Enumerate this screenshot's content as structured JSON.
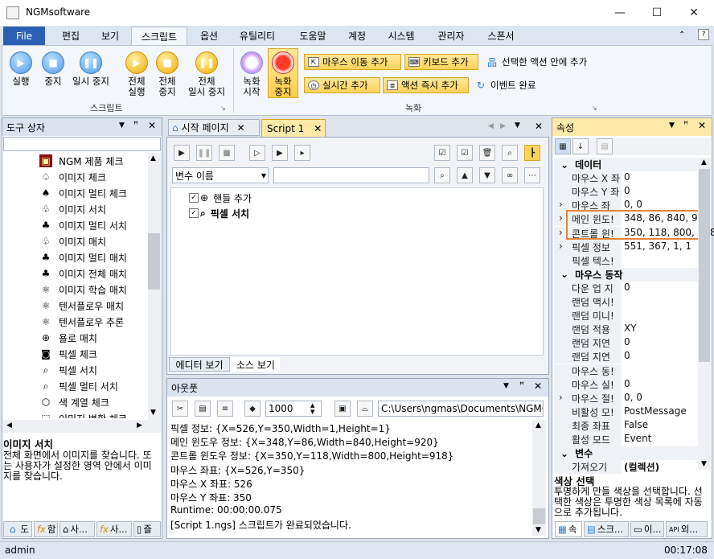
{
  "title_bar": {
    "title": "NGMsoftware",
    "minimize": "—",
    "maximize": "☐",
    "close": "✕"
  },
  "menu": {
    "file": "File",
    "tabs": [
      "편집",
      "보기",
      "스크립트",
      "옵션",
      "유틸리티",
      "도움말",
      "계정",
      "시스템",
      "관리자",
      "스폰서"
    ],
    "active_tab": "스크립트"
  },
  "ribbon": {
    "script_group": {
      "label": "스크립트",
      "run": "실행",
      "stop": "중지",
      "pause": "일시 중지",
      "run_all_1": "전체",
      "run_all_2": "실행",
      "stop_all_1": "전체",
      "stop_all_2": "중지",
      "pause_all_1": "전체",
      "pause_all_2": "일시 중지"
    },
    "record_group": {
      "label": "녹화",
      "record_start_1": "녹화",
      "record_start_2": "시작",
      "record_stop_1": "녹화",
      "record_stop_2": "중지",
      "add_mouse_move": "마우스 이동 추가",
      "add_keyboard": "키보드 추가",
      "add_in_action": "선택한 액션 안에 추가",
      "add_realtime": "실시간 추가",
      "add_action_now": "액션 즉시 추가",
      "event_complete": "이벤트 완료"
    }
  },
  "toolbox": {
    "title": "도구 상자",
    "items": [
      {
        "label": "NGM 제품 체크",
        "icon": "ngm-icon"
      },
      {
        "label": "이미지 체크",
        "icon": "tree-outline-icon"
      },
      {
        "label": "이미지 멀티 체크",
        "icon": "tree-icon"
      },
      {
        "label": "이미지 서치",
        "icon": "trees-outline-icon"
      },
      {
        "label": "이미지 멀티 서치",
        "icon": "trees-icon"
      },
      {
        "label": "이미지 매치",
        "icon": "trees-outline-icon"
      },
      {
        "label": "이미지 멀티 매치",
        "icon": "forest-icon"
      },
      {
        "label": "이미지 전체 매치",
        "icon": "forest-icon"
      },
      {
        "label": "이미지 학습 매치",
        "icon": "atom-icon"
      },
      {
        "label": "텐서플로우 매치",
        "icon": "atom-icon"
      },
      {
        "label": "텐서플로우 추론",
        "icon": "atom-icon"
      },
      {
        "label": "욜로 매치",
        "icon": "target-icon"
      },
      {
        "label": "픽셀 체크",
        "icon": "camera-icon"
      },
      {
        "label": "픽셀 서치",
        "icon": "magnifier-icon"
      },
      {
        "label": "픽셀 멀티 서치",
        "icon": "magnifier-icon"
      },
      {
        "label": "색 계열 체크",
        "icon": "cube-icon"
      },
      {
        "label": "이미지 변환 체크",
        "icon": "dashed-box-icon"
      }
    ],
    "desc_title": "이미지 서치",
    "desc_text": "전체 화면에서 이미지를 찾습니다. 또는 사용자가 설정한 영역 안에서 이미지를 찾습니다.",
    "bottom_tabs": [
      "도",
      "함",
      "사...",
      "사...",
      "즐"
    ]
  },
  "editor": {
    "tabs": [
      "시작 페이지",
      "Script 1"
    ],
    "active_tab": "Script 1",
    "var_select": "변수 이름",
    "tree": [
      "핸들 추가",
      "픽셀 서치"
    ],
    "view_tabs": [
      "에디터 보기",
      "소스 보기"
    ]
  },
  "output": {
    "title": "아웃풋",
    "count_value": "1000",
    "path": "C:\\Users\\ngmas\\Documents\\NGM6\\",
    "lines": [
      "픽셀 정보: {X=526,Y=350,Width=1,Height=1}",
      "메인 윈도우 정보: {X=348,Y=86,Width=840,Height=920}",
      "콘트롤 윈도우 정보: {X=350,Y=118,Width=800,Height=918}",
      "마우스 좌표: {X=526,Y=350}",
      "마우스 X 좌표: 526",
      "마우스 Y 좌표: 350",
      "Runtime: 00:00:00.075",
      "[Script 1.ngs] 스크립트가 완료되었습니다."
    ]
  },
  "properties": {
    "title": "속성",
    "rows": [
      {
        "type": "cat",
        "k": "데이터"
      },
      {
        "type": "row",
        "k": "마우스 X 좌",
        "v": "0"
      },
      {
        "type": "row",
        "k": "마우스 Y 좌",
        "v": "0"
      },
      {
        "type": "row",
        "k": "마우스 좌",
        "v": "0, 0",
        "exp": true
      },
      {
        "type": "row",
        "k": "메인 윈도!",
        "v": "348, 86, 840, 920",
        "exp": true,
        "hl": true
      },
      {
        "type": "row",
        "k": "콘트롤 윈!",
        "v": "350, 118, 800, 918",
        "exp": true,
        "hl": true
      },
      {
        "type": "row",
        "k": "픽셀 정보",
        "v": "551, 367, 1, 1",
        "exp": true
      },
      {
        "type": "row",
        "k": "픽셀 텍스!",
        "v": ""
      },
      {
        "type": "cat",
        "k": "마우스 동작"
      },
      {
        "type": "row",
        "k": "다운 업 지",
        "v": "0"
      },
      {
        "type": "row",
        "k": "랜덤 맥시!",
        "v": ""
      },
      {
        "type": "row",
        "k": "랜덤 미니!",
        "v": ""
      },
      {
        "type": "row",
        "k": "랜덤 적용",
        "v": "XY"
      },
      {
        "type": "row",
        "k": "랜덤 지연",
        "v": "0"
      },
      {
        "type": "row",
        "k": "랜덤 지연",
        "v": "0"
      },
      {
        "type": "row",
        "k": "마우스 동!",
        "v": ""
      },
      {
        "type": "row",
        "k": "마우스 실!",
        "v": "0"
      },
      {
        "type": "row",
        "k": "마우스 절!",
        "v": "0, 0",
        "exp": true
      },
      {
        "type": "row",
        "k": "비활성 모!",
        "v": "PostMessage"
      },
      {
        "type": "row",
        "k": "최종 좌표",
        "v": "False"
      },
      {
        "type": "row",
        "k": "활성 모드",
        "v": "Event"
      },
      {
        "type": "cat",
        "k": "변수"
      },
      {
        "type": "row",
        "k": "가져오기",
        "v": "(컬렉션)"
      }
    ],
    "desc_title": "색상 선택",
    "desc_text": "투명하게 만들 색상을 선택합니다. 선택한 색상은 투명한 색상 목록에 자동으로 추가됩니다.",
    "bottom_tabs": [
      "속",
      "스크...",
      "이...",
      "외..."
    ]
  },
  "status_bar": {
    "user": "admin",
    "time": "00:17:08"
  },
  "colors": {
    "accent": "#2b5fb3",
    "highlight_border": "#e8843a",
    "toolbar_yellow": "#ffd35a"
  }
}
